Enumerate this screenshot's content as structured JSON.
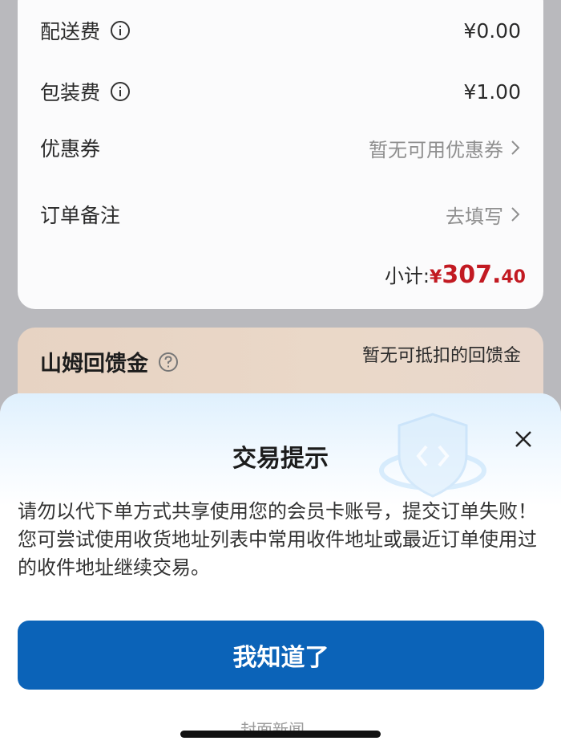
{
  "fees": [
    {
      "label": "配送费",
      "value": "¥0.00"
    },
    {
      "label": "包装费",
      "value": "¥1.00"
    }
  ],
  "coupon": {
    "label": "优惠券",
    "value": "暂无可用优惠券"
  },
  "remark": {
    "label": "订单备注",
    "value": "去填写"
  },
  "subtotal": {
    "label": "小计:",
    "currency": "¥",
    "integer": "307.",
    "decimal": "40"
  },
  "cashback": {
    "title": "山姆回馈金",
    "note": "暂无可抵扣的回馈金"
  },
  "dialog": {
    "title": "交易提示",
    "message": "请勿以代下单方式共享使用您的会员卡账号，提交订单失败！您可尝试使用收货地址列表中常用收件地址或最近订单使用过的收件地址继续交易。",
    "confirm_label": "我知道了"
  },
  "watermark": "封面新闻",
  "colors": {
    "accent": "#0b63b8",
    "price": "#c21a22"
  }
}
